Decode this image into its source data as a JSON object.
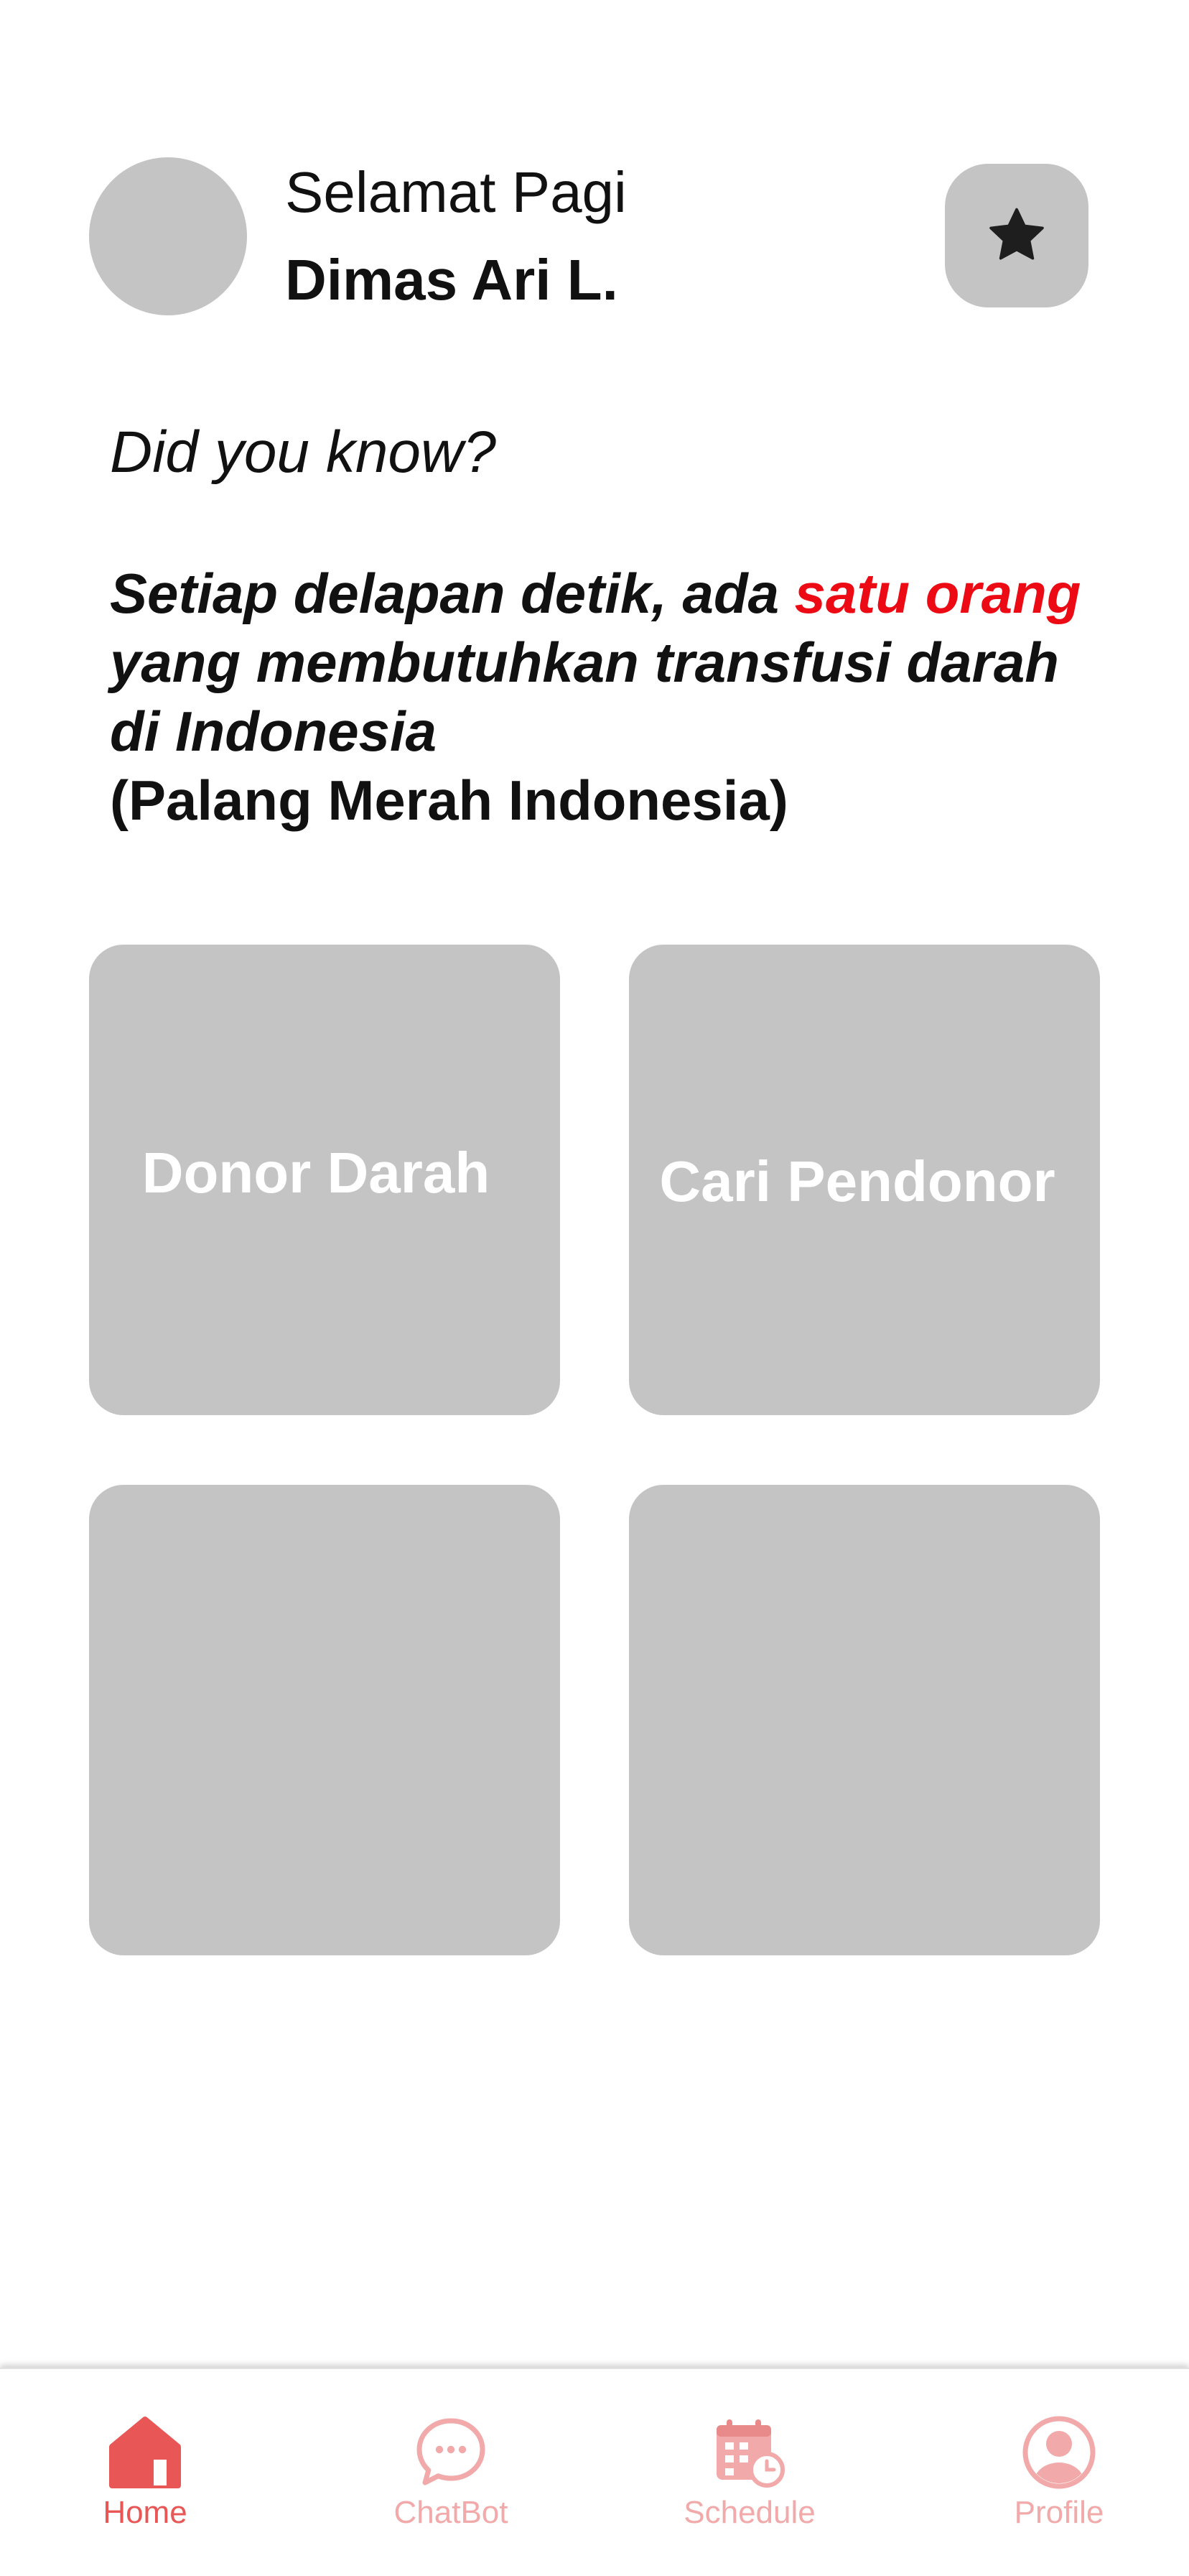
{
  "header": {
    "greeting": "Selamat Pagi",
    "user_name": "Dimas Ari L.",
    "favorite_icon": "star-icon"
  },
  "did_you_know": {
    "title": "Did you know?",
    "fact_part1": "Setiap delapan detik, ada ",
    "fact_highlight": "satu orang",
    "fact_part2": " yang membutuhkan transfusi darah di Indonesia",
    "fact_source": "(Palang Merah Indonesia)"
  },
  "features": [
    {
      "label": "Donor Darah"
    },
    {
      "label": "Cari Pendonor"
    },
    {
      "label": ""
    },
    {
      "label": ""
    }
  ],
  "bottom_nav": {
    "items": [
      {
        "label": "Home",
        "icon": "home-icon",
        "active": true
      },
      {
        "label": "ChatBot",
        "icon": "chat-bubble-icon",
        "active": false
      },
      {
        "label": "Schedule",
        "icon": "calendar-icon",
        "active": false
      },
      {
        "label": "Profile",
        "icon": "user-icon",
        "active": false
      }
    ]
  },
  "colors": {
    "accent": "#EC0B14",
    "nav_active": "#E95656",
    "nav_inactive": "#F2A9A9",
    "placeholder_gray": "#C4C4C4"
  }
}
